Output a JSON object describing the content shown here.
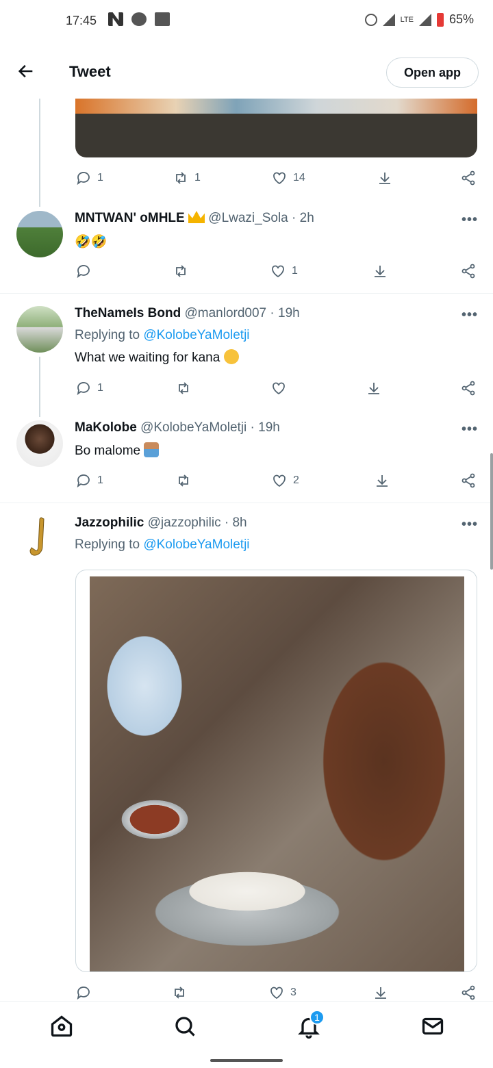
{
  "status_bar": {
    "time": "17:45",
    "battery": "65%",
    "network": "LTE"
  },
  "header": {
    "title": "Tweet",
    "open_app": "Open app",
    "back_icon": "arrow-left-icon"
  },
  "tweets": [
    {
      "actions": {
        "reply": "1",
        "retweet": "1",
        "like": "14"
      }
    },
    {
      "display_name": "MNTWAN' oMHLE",
      "handle": "@Lwazi_Sola",
      "time": "· 2h",
      "text": "🤣🤣",
      "actions": {
        "reply": "",
        "retweet": "",
        "like": "1"
      }
    },
    {
      "display_name": "TheNameIs Bond",
      "handle": "@manlord007",
      "time": "· 19h",
      "replying_prefix": "Replying to",
      "replying_to": "@KolobeYaMoletji",
      "text": "What we waiting for kana",
      "actions": {
        "reply": "1",
        "retweet": "",
        "like": ""
      }
    },
    {
      "display_name": "MaKolobe",
      "handle": "@KolobeYaMoletji",
      "time": "· 19h",
      "text": "Bo malome",
      "actions": {
        "reply": "1",
        "retweet": "",
        "like": "2"
      }
    },
    {
      "display_name": "Jazzophilic",
      "handle": "@jazzophilic",
      "time": "· 8h",
      "replying_prefix": "Replying to",
      "replying_to": "@KolobeYaMoletji",
      "actions": {
        "reply": "",
        "retweet": "",
        "like": "3"
      }
    }
  ],
  "more_label": "•••",
  "bottom_nav": {
    "notifications_badge": "1",
    "items": [
      "home-icon",
      "search-icon",
      "bell-icon",
      "mail-icon"
    ]
  },
  "colors": {
    "link": "#1d9bf0",
    "secondary_text": "#536471",
    "badge": "#1d9bf0"
  }
}
